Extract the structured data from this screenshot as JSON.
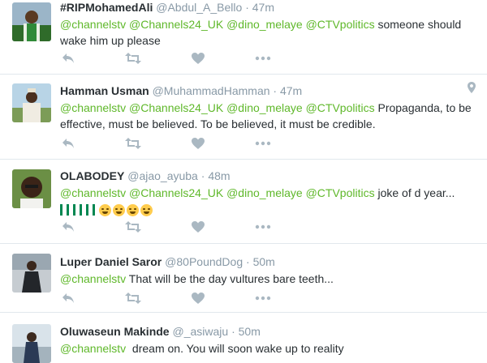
{
  "tweets": [
    {
      "name": "#RIPMohamedAli",
      "handle": "@Abdul_A_Bello",
      "sep": "·",
      "time": "47m",
      "mentions": "@channelstv @Channels24_UK @dino_melaye @CTVpolitics",
      "text": " someone should wake him up please",
      "avatar_color": "#3a6d2f"
    },
    {
      "name": "Hamman Usman",
      "handle": "@MuhammadHamman",
      "sep": "·",
      "time": "47m",
      "mentions": "@channelstv @Channels24_UK @dino_melaye @CTVpolitics",
      "text": " Propaganda, to be effective, must be believed. To be believed, it must be credible.",
      "avatar_color": "#c9c2b0",
      "has_location": true
    },
    {
      "name": "OLABODEY",
      "handle": "@ajao_ayuba",
      "sep": "·",
      "time": "48m",
      "mentions": "@channelstv @Channels24_UK @dino_melaye @CTVpolitics",
      "text": " joke of d year...",
      "avatar_color": "#5b7c3a"
    },
    {
      "name": "Luper Daniel Saror",
      "handle": "@80PoundDog",
      "sep": "·",
      "time": "50m",
      "mentions": "@channelstv",
      "text": " That will be the day vultures bare teeth...",
      "avatar_color": "#6f7a85"
    },
    {
      "name": "Oluwaseun Makinde",
      "handle": "@_asiwaju",
      "sep": "·",
      "time": "50m",
      "mentions": "@channelstv",
      "text": "  dream on. You will soon wake up to reality",
      "avatar_color": "#8c9aa6"
    }
  ],
  "icons": [
    "reply-icon",
    "retweet-icon",
    "like-icon",
    "more-icon",
    "location-pin-icon"
  ],
  "colors": {
    "mention": "#5fb82a",
    "muted": "#8899a6",
    "icon": "#aab8c2",
    "divider": "#e1e8ed"
  }
}
